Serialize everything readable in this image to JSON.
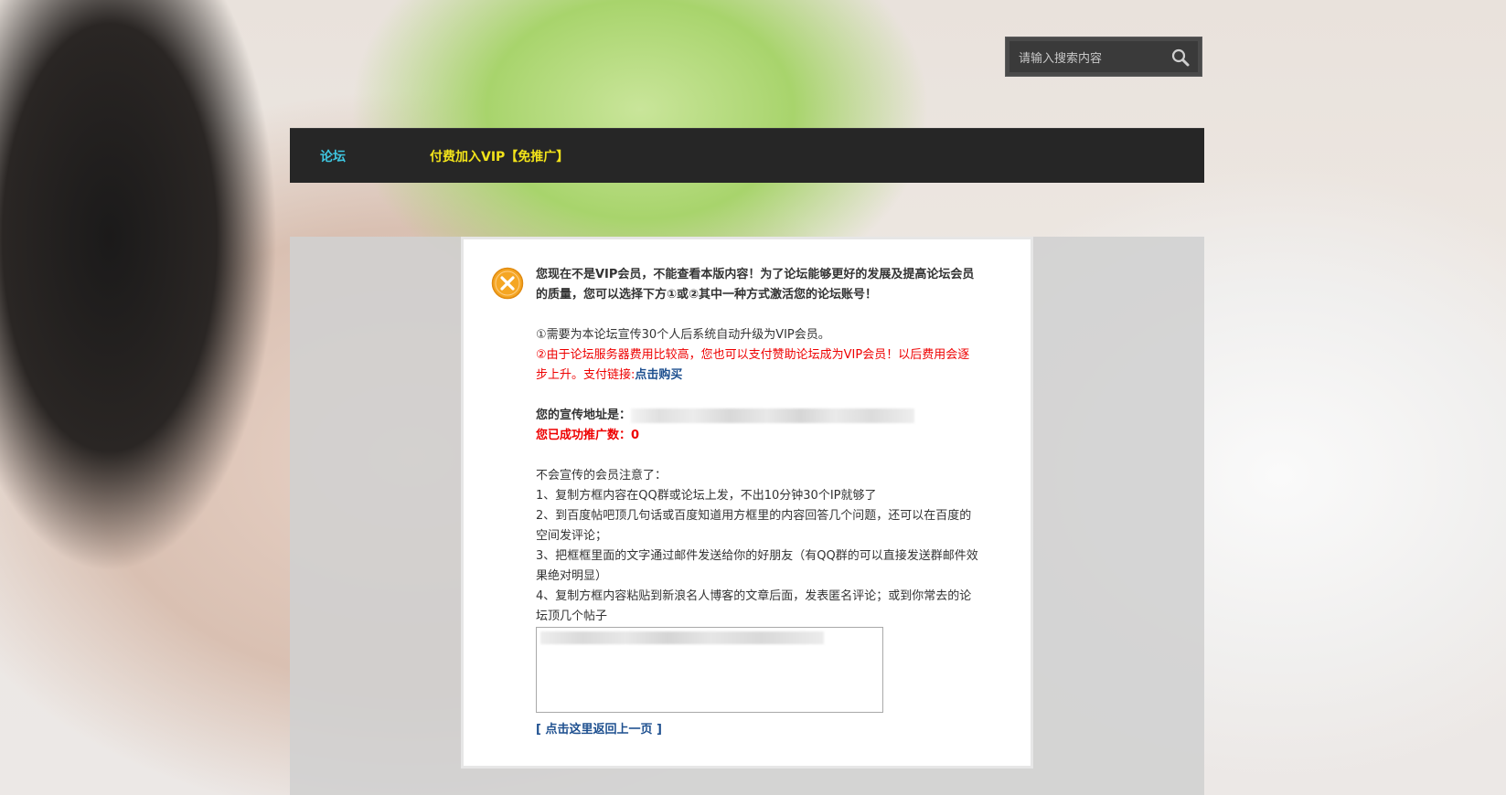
{
  "search": {
    "placeholder": "请输入搜索内容"
  },
  "nav": {
    "forum_label": "论坛",
    "vip_label": "付费加入VIP【免推广】"
  },
  "message": {
    "headline_1": "您现在不是VIP会员，不能查看本版内容！为了论坛能够更好的发展及提高论坛会员",
    "headline_2": "的质量，您可以选择下方①或②其中一种方式激活您的论坛账号！",
    "option_1": "①需要为本论坛宣传30个人后系统自动升级为VIP会员。",
    "option_2_line1": "②由于论坛服务器费用比较高，您也可以支付赞助论坛成为VIP会员！以后费用会逐",
    "option_2_line2": "步上升。支付链接:",
    "buy_link": "点击购买",
    "promo_address_label": "您的宣传地址是：",
    "promo_count": "您已成功推广数：0",
    "tips_title": "不会宣传的会员注意了：",
    "tip_1": "1、复制方框内容在QQ群或论坛上发，不出10分钟30个IP就够了",
    "tip_2_line1": "2、到百度帖吧顶几句话或百度知道用方框里的内容回答几个问题，还可以在百度的",
    "tip_2_line2": "空间发评论；",
    "tip_3_line1": "3、把框框里面的文字通过邮件发送给你的好朋友（有QQ群的可以直接发送群邮件效",
    "tip_3_line2": "果绝对明显）",
    "tip_4_line1": "4、复制方框内容粘贴到新浪名人博客的文章后面，发表匿名评论；或到你常去的论",
    "tip_4_line2": "坛顶几个帖子",
    "back_link": "[ 点击这里返回上一页 ]"
  },
  "colors": {
    "nav_bg": "#262626",
    "nav_forum": "#3ec6e0",
    "nav_vip": "#f2e31a",
    "error_orange": "#f5a623",
    "red_text": "#e00000",
    "link_blue": "#1d4f8f"
  }
}
